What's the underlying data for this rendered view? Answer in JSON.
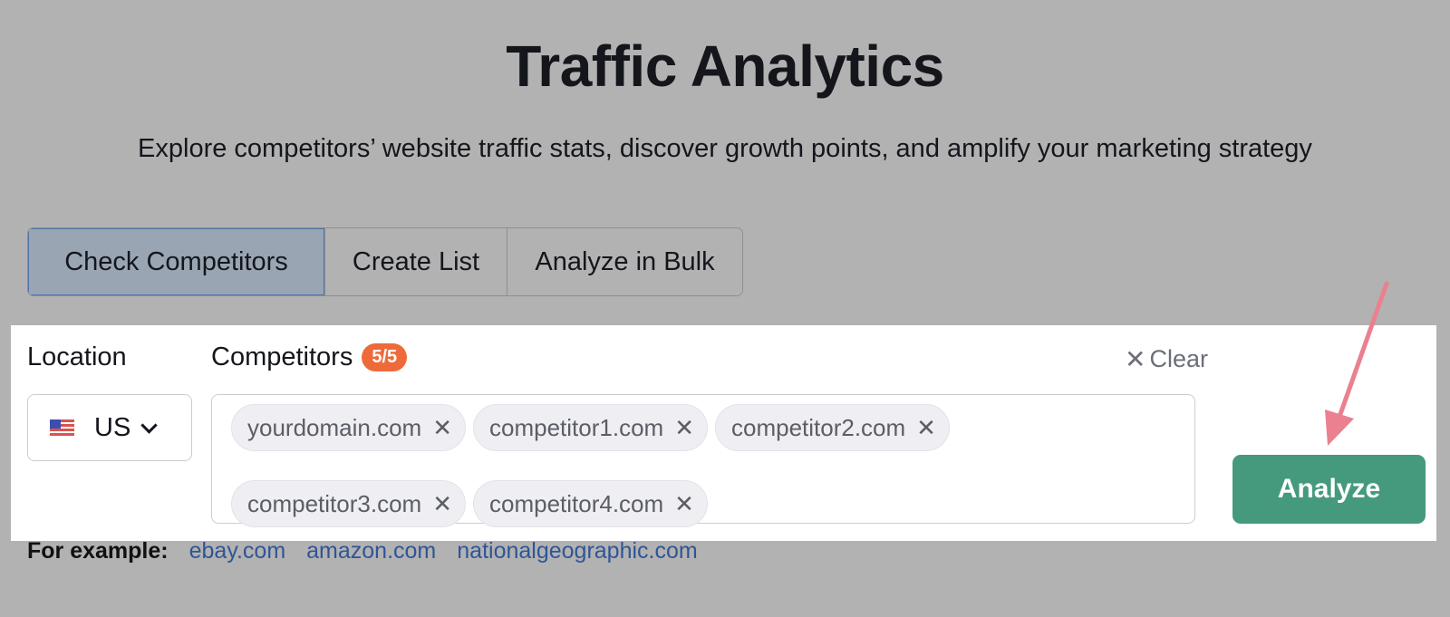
{
  "header": {
    "title": "Traffic Analytics",
    "subtitle": "Explore competitors’ website traffic stats, discover growth points, and amplify your marketing strategy"
  },
  "tabs": [
    {
      "label": "Check Competitors",
      "active": true
    },
    {
      "label": "Create List",
      "active": false
    },
    {
      "label": "Analyze in Bulk",
      "active": false
    }
  ],
  "form": {
    "location_label": "Location",
    "location_value": "US",
    "location_icon": "us-flag-icon",
    "competitors_label": "Competitors",
    "competitors_count": "5/5",
    "clear_label": "Clear",
    "chips": [
      "yourdomain.com",
      "competitor1.com",
      "competitor2.com",
      "competitor3.com",
      "competitor4.com"
    ],
    "chip_remove_glyph": "✕",
    "analyze_label": "Analyze"
  },
  "examples": {
    "label": "For example:",
    "links": [
      "ebay.com",
      "amazon.com",
      "nationalgeographic.com"
    ]
  },
  "annotation": {
    "arrow_color": "#ea8090",
    "target": "analyze-button"
  },
  "colors": {
    "background_overlay": "#b2b2b2",
    "accent_badge": "#ef6a3a",
    "analyze_button": "#459a7e",
    "link": "#2f5597"
  }
}
